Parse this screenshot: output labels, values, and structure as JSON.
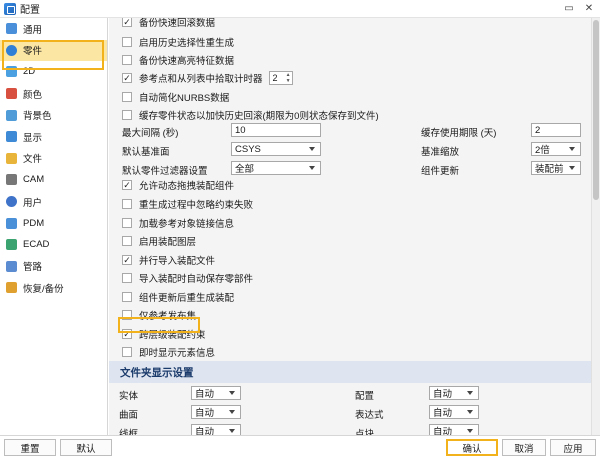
{
  "window": {
    "title": "配置"
  },
  "sidebar": {
    "items": [
      {
        "label": "通用",
        "icon": "general-icon",
        "color": "#4a8fd9"
      },
      {
        "label": "零件",
        "icon": "part-icon",
        "color": "#2f7fd6",
        "active": true
      },
      {
        "label": "2D",
        "icon": "drawing-2d-icon",
        "color": "#4aa0e0"
      },
      {
        "label": "颜色",
        "icon": "color-icon",
        "color": "#d8503f"
      },
      {
        "label": "背景色",
        "icon": "background-icon",
        "color": "#4f9cd9"
      },
      {
        "label": "显示",
        "icon": "display-icon",
        "color": "#3f8ad6"
      },
      {
        "label": "文件",
        "icon": "folder-icon",
        "color": "#e8b43a"
      },
      {
        "label": "CAM",
        "icon": "cam-icon",
        "color": "#777777"
      },
      {
        "label": "用户",
        "icon": "user-icon",
        "color": "#3f73c9"
      },
      {
        "label": "PDM",
        "icon": "pdm-icon",
        "color": "#4a90d9"
      },
      {
        "label": "ECAD",
        "icon": "ecad-icon",
        "color": "#3aa36f"
      },
      {
        "label": "管路",
        "icon": "pipe-icon",
        "color": "#5b8bd0"
      },
      {
        "label": "恢复/备份",
        "icon": "restore-icon",
        "color": "#e0a030"
      }
    ]
  },
  "options": {
    "top_partial": "备份快速回滚数据",
    "opt1": "启用历史选择性重生成",
    "opt2": "备份快速高亮特征数据",
    "opt3": "参考点和从列表中拾取计时器",
    "opt3_value": "2",
    "opt4": "自动简化NURBS数据",
    "opt5": "缓存零件状态以加快历史回滚(期限为0则状态保存到文件)"
  },
  "fields": {
    "max_interval_label": "最大间隔 (秒)",
    "max_interval_value": "10",
    "cache_period_label": "缓存使用期限 (天)",
    "cache_period_value": "2",
    "default_plane_label": "默认基准面",
    "default_plane_value": "CSYS",
    "datum_scale_label": "基准缩放",
    "datum_scale_value": "2倍",
    "default_filter_label": "默认零件过滤器设置",
    "default_filter_value": "全部",
    "component_update_label": "组件更新",
    "component_update_value": "装配前"
  },
  "options2": {
    "o1": "允许动态拖拽装配组件",
    "o2": "重生成过程中忽略约束失败",
    "o3": "加载参考对象链接信息",
    "o4": "启用装配图层",
    "o5": "并行导入装配文件",
    "o6": "导入装配时自动保存零部件",
    "o7": "组件更新后重生成装配",
    "o8": "仅参考发布集",
    "o9": "跨层级装配约束",
    "o10": "即时显示元素信息"
  },
  "folder_display": {
    "section_title": "文件夹显示设置",
    "rows": [
      {
        "left_label": "实体",
        "left_value": "自动",
        "right_label": "配置",
        "right_value": "自动"
      },
      {
        "left_label": "曲面",
        "left_value": "自动",
        "right_label": "表达式",
        "right_value": "自动"
      },
      {
        "left_label": "线框",
        "left_value": "自动",
        "right_label": "点块",
        "right_value": "自动"
      }
    ]
  },
  "footer": {
    "reset": "重置",
    "default": "默认",
    "ok": "确认",
    "cancel": "取消",
    "apply": "应用"
  },
  "colors": {
    "accent_highlight": "#f2b21b",
    "active_item_bg": "#fbe6a4",
    "section_bg": "#dfe5f0",
    "section_text": "#1a3a6b"
  }
}
